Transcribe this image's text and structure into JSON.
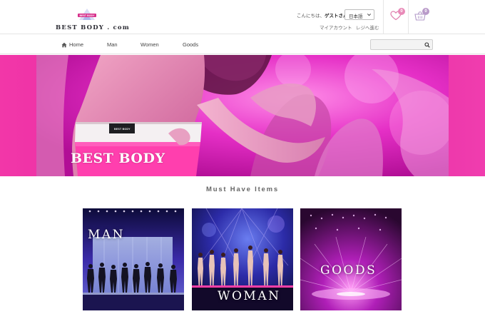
{
  "header": {
    "logo_badge_text": "BEST BODY",
    "logo_text": "BEST BODY . com",
    "greeting_prefix": "こんにちは、",
    "greeting_name": "ゲストさん",
    "language": "日本語",
    "account_link": "マイアカウント",
    "checkout_link": "レジへ進む",
    "wishlist_count": "0",
    "cart_count": "0"
  },
  "nav": {
    "items": [
      "Home",
      "Man",
      "Women",
      "Goods"
    ],
    "search_placeholder": ""
  },
  "hero": {
    "brand_text": "BEST BODY",
    "waist_tag": "BEST BODY"
  },
  "section": {
    "title": "Must Have Items",
    "tiles": [
      {
        "label": "MAN"
      },
      {
        "label": "WOMAN"
      },
      {
        "label": "GOODS"
      }
    ]
  },
  "colors": {
    "accent_pink": "#e01fa0",
    "badge_pink": "#e98ab8",
    "badge_purple": "#b99ac9",
    "wishlist_icon": "#e07fae",
    "cart_icon": "#b29ac8"
  },
  "icons": {
    "home": "home-icon",
    "search": "search-icon",
    "wishlist": "heart-icon",
    "cart": "basket-icon",
    "caret": "chevron-down-icon"
  }
}
